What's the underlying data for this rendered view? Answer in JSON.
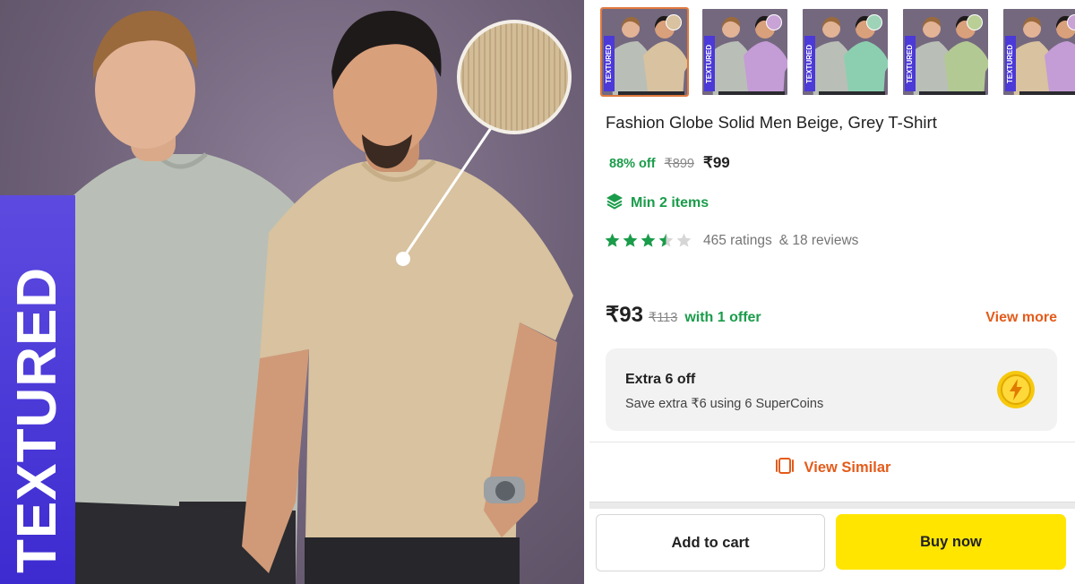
{
  "hero": {
    "badge_text": "TEXTURED",
    "colors": {
      "bg": "#6e6178",
      "badge": "#3d2bd0",
      "beige": "#d8c29f",
      "grey": "#b9bfb6"
    }
  },
  "thumbnails": [
    {
      "tag": "TEXTURED",
      "swatch": "#d8c29f",
      "shirt_left": "#b9bfb6",
      "shirt_right": "#d8c29f",
      "active": true
    },
    {
      "tag": "TEXTURED",
      "swatch": "#c9a3d6",
      "shirt_left": "#b9bfb6",
      "shirt_right": "#c49cd6",
      "active": false
    },
    {
      "tag": "TEXTURED",
      "swatch": "#9fd3b8",
      "shirt_left": "#b9bfb6",
      "shirt_right": "#8ccfb0",
      "active": false
    },
    {
      "tag": "TEXTURED",
      "swatch": "#b9cf96",
      "shirt_left": "#b9bfb6",
      "shirt_right": "#b3c993",
      "active": false
    },
    {
      "tag": "TEXTURED",
      "swatch": "#c9a3d6",
      "shirt_left": "#d8c29f",
      "shirt_right": "#c49cd6",
      "active": false
    }
  ],
  "product": {
    "title": "Fashion Globe Solid Men Beige, Grey T-Shirt",
    "discount": "88% off",
    "mrp": "₹899",
    "price": "₹99",
    "min_items": "Min 2 items",
    "rating_value": 3.5,
    "ratings": "465 ratings",
    "reviews": "& 18 reviews"
  },
  "offer": {
    "price": "₹93",
    "mrp": "₹113",
    "text": "with 1 offer",
    "view_more": "View more"
  },
  "supercoins": {
    "title": "Extra 6 off",
    "subtitle": "Save extra ₹6 using 6 SuperCoins"
  },
  "view_similar": "View Similar",
  "buttons": {
    "add_to_cart": "Add to cart",
    "buy_now": "Buy now"
  },
  "colors": {
    "green": "#1a9c4a",
    "orange": "#e45b1a",
    "yellow": "#ffe500",
    "star": "#1a9c4a"
  }
}
